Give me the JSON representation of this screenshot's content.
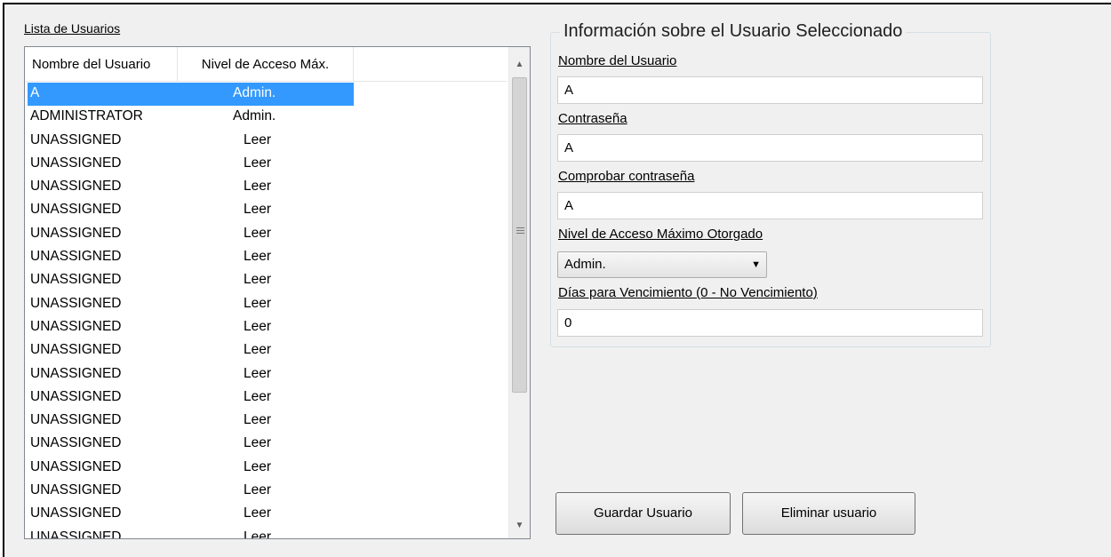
{
  "list": {
    "label": "Lista de Usuarios",
    "columns": [
      "Nombre del Usuario",
      "Nivel de Acceso Máx."
    ],
    "rows": [
      {
        "name": "A",
        "level": "Admin."
      },
      {
        "name": "ADMINISTRATOR",
        "level": "Admin."
      },
      {
        "name": "UNASSIGNED",
        "level": "Leer"
      },
      {
        "name": "UNASSIGNED",
        "level": "Leer"
      },
      {
        "name": "UNASSIGNED",
        "level": "Leer"
      },
      {
        "name": "UNASSIGNED",
        "level": "Leer"
      },
      {
        "name": "UNASSIGNED",
        "level": "Leer"
      },
      {
        "name": "UNASSIGNED",
        "level": "Leer"
      },
      {
        "name": "UNASSIGNED",
        "level": "Leer"
      },
      {
        "name": "UNASSIGNED",
        "level": "Leer"
      },
      {
        "name": "UNASSIGNED",
        "level": "Leer"
      },
      {
        "name": "UNASSIGNED",
        "level": "Leer"
      },
      {
        "name": "UNASSIGNED",
        "level": "Leer"
      },
      {
        "name": "UNASSIGNED",
        "level": "Leer"
      },
      {
        "name": "UNASSIGNED",
        "level": "Leer"
      },
      {
        "name": "UNASSIGNED",
        "level": "Leer"
      },
      {
        "name": "UNASSIGNED",
        "level": "Leer"
      },
      {
        "name": "UNASSIGNED",
        "level": "Leer"
      },
      {
        "name": "UNASSIGNED",
        "level": "Leer"
      },
      {
        "name": "UNASSIGNED",
        "level": "Leer"
      }
    ],
    "selected_index": 0,
    "selection_color": "#3399ff"
  },
  "details": {
    "title": "Información sobre el Usuario Seleccionado",
    "username_label": "Nombre del Usuario",
    "username_value": "A",
    "password_label": "Contraseña",
    "password_value": "A",
    "confirm_label": "Comprobar contraseña",
    "confirm_value": "A",
    "access_label": "Nivel de Acceso Máximo Otorgado",
    "access_value": "Admin.",
    "expiry_label": "Días para Vencimiento (0 - No Vencimiento)",
    "expiry_value": "0"
  },
  "buttons": {
    "save": "Guardar Usuario",
    "delete": "Eliminar usuario"
  },
  "icons": {
    "scroll_up": "scroll-up-arrow-icon",
    "scroll_down": "scroll-down-arrow-icon",
    "dropdown": "chevron-down-icon"
  }
}
